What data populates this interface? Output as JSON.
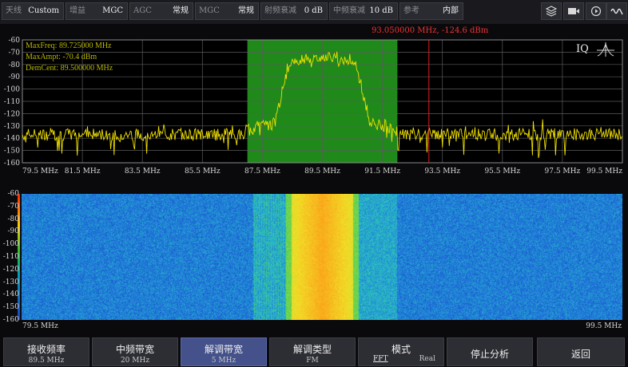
{
  "toolbar": {
    "antenna": {
      "label": "天线",
      "value": "Custom"
    },
    "gain": {
      "label": "增益",
      "value": "MGC"
    },
    "agc": {
      "label": "AGC",
      "value": "常规"
    },
    "mgc": {
      "label": "MGC",
      "value": "常规"
    },
    "rf_atten": {
      "label": "射频衰减",
      "value": "0 dB"
    },
    "if_atten": {
      "label": "中频衰减",
      "value": "10 dB"
    },
    "reference": {
      "label": "参考",
      "value": "内部"
    },
    "icons": [
      "layers-icon",
      "record-icon",
      "play-icon",
      "waveform-icon"
    ]
  },
  "spectrum": {
    "marker_readout": "93.050000 MHz, -124.6 dBm",
    "info": {
      "max_freq": "MaxFreq:   89.725000 MHz",
      "max_ampt": "MaxAmpt:  -70.4 dBm",
      "dem_cent": "DemCent:   89.500000 MHz"
    },
    "mode_label": "IQ",
    "y_ticks": [
      "-60",
      "-70",
      "-80",
      "-90",
      "-100",
      "-110",
      "-120",
      "-130",
      "-140",
      "-150",
      "-160"
    ],
    "x_ticks": [
      "79.5 MHz",
      "81.5 MHz",
      "83.5 MHz",
      "85.5 MHz",
      "87.5 MHz",
      "89.5 MHz",
      "91.5 MHz",
      "93.5 MHz",
      "95.5 MHz",
      "97.5 MHz",
      "99.5 MHz"
    ],
    "colors": {
      "trace": "#f0e000",
      "band": "#1f8a1a",
      "marker": "#e02020"
    }
  },
  "chart_data": {
    "type": "line",
    "x_range_mhz": [
      79.5,
      99.5
    ],
    "y_range_dbm": [
      -160,
      -60
    ],
    "noise_floor_dbm": -137,
    "demod_band_mhz": [
      87.0,
      92.0
    ],
    "signal_peak_mhz": 89.725,
    "signal_peak_dbm": -70.4,
    "marker_mhz": 93.05,
    "marker_dbm": -124.6
  },
  "waterfall": {
    "y_ticks": [
      "-60",
      "-70",
      "-80",
      "-90",
      "-100",
      "-110",
      "-120",
      "-130",
      "-140",
      "-150",
      "-160"
    ],
    "x_start": "79.5 MHz",
    "x_end": "99.5 MHz"
  },
  "bottom": {
    "buttons": [
      {
        "title": "接收频率",
        "sub": "89.5 MHz"
      },
      {
        "title": "中频带宽",
        "sub": "20 MHz"
      },
      {
        "title": "解调带宽",
        "sub": "5 MHz"
      },
      {
        "title": "解调类型",
        "sub": "FM"
      },
      {
        "title": "模式",
        "left": "FFT",
        "right": "Real"
      },
      {
        "title": "停止分析",
        "sub": ""
      },
      {
        "title": "返回",
        "sub": ""
      }
    ]
  }
}
